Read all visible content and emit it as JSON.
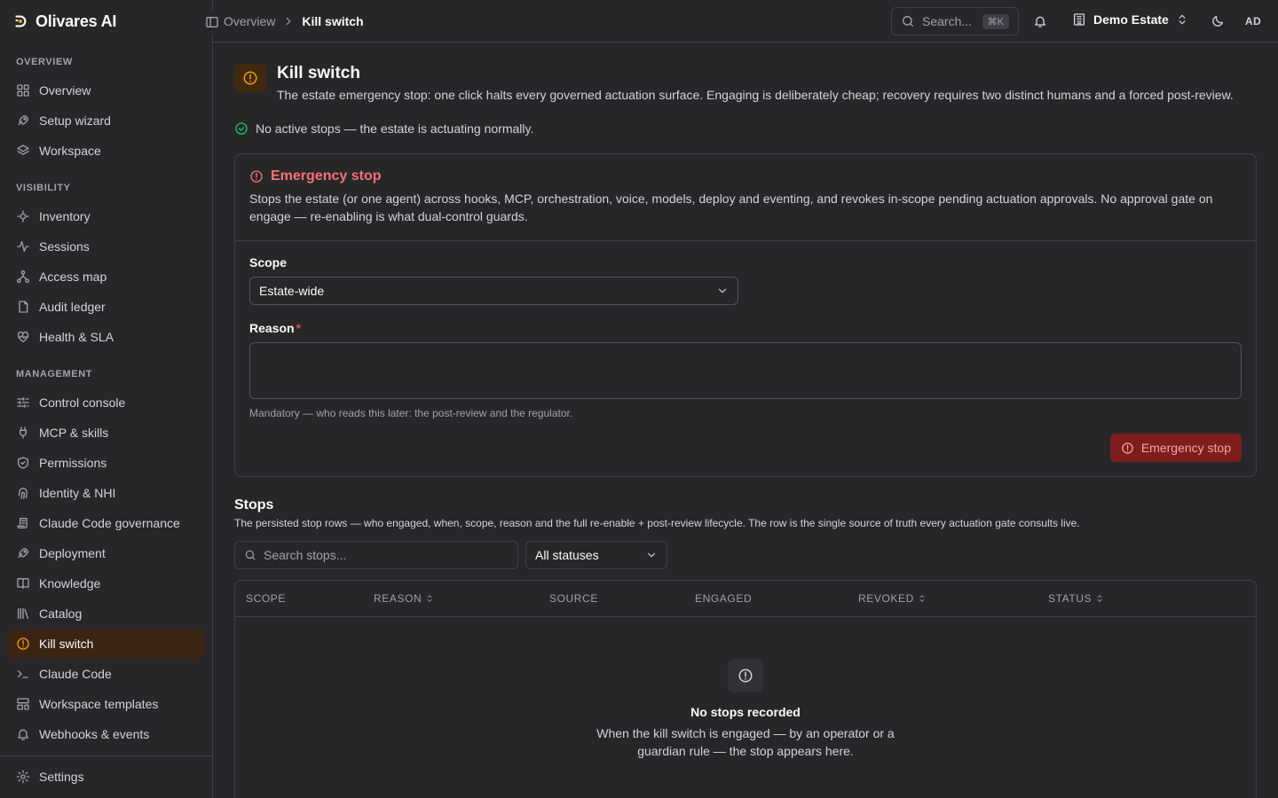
{
  "app": {
    "name": "Olivares AI"
  },
  "sidebar": {
    "sections": [
      {
        "label": "OVERVIEW",
        "items": [
          {
            "label": "Overview",
            "icon": "dashboard-icon"
          },
          {
            "label": "Setup wizard",
            "icon": "rocket-icon"
          },
          {
            "label": "Workspace",
            "icon": "layers-icon"
          }
        ]
      },
      {
        "label": "VISIBILITY",
        "items": [
          {
            "label": "Inventory",
            "icon": "inventory-icon"
          },
          {
            "label": "Sessions",
            "icon": "activity-icon"
          },
          {
            "label": "Access map",
            "icon": "network-icon"
          },
          {
            "label": "Audit ledger",
            "icon": "file-icon"
          },
          {
            "label": "Health & SLA",
            "icon": "heart-pulse-icon"
          }
        ]
      },
      {
        "label": "MANAGEMENT",
        "items": [
          {
            "label": "Control console",
            "icon": "sliders-icon"
          },
          {
            "label": "MCP & skills",
            "icon": "plug-icon"
          },
          {
            "label": "Permissions",
            "icon": "shield-icon"
          },
          {
            "label": "Identity & NHI",
            "icon": "fingerprint-icon"
          },
          {
            "label": "Claude Code governance",
            "icon": "scroll-icon"
          },
          {
            "label": "Deployment",
            "icon": "rocket-icon"
          },
          {
            "label": "Knowledge",
            "icon": "book-icon"
          },
          {
            "label": "Catalog",
            "icon": "library-icon"
          },
          {
            "label": "Kill switch",
            "icon": "alert-circle-icon",
            "active": true
          },
          {
            "label": "Claude Code",
            "icon": "terminal-icon"
          },
          {
            "label": "Workspace templates",
            "icon": "template-icon"
          },
          {
            "label": "Webhooks & events",
            "icon": "bell-icon"
          }
        ]
      }
    ],
    "footer": {
      "label": "Settings",
      "icon": "gear-icon"
    }
  },
  "topbar": {
    "breadcrumb": [
      "Overview",
      "Kill switch"
    ],
    "search_placeholder": "Search...",
    "search_shortcut": "⌘K",
    "estate": "Demo Estate",
    "avatar": "AD"
  },
  "page": {
    "title": "Kill switch",
    "description": "The estate emergency stop: one click halts every governed actuation surface. Engaging is deliberately cheap; recovery requires two distinct humans and a forced post-review.",
    "status": "No active stops — the estate is actuating normally."
  },
  "emergency": {
    "title": "Emergency stop",
    "description": "Stops the estate (or one agent) across hooks, MCP, orchestration, voice, models, deploy and eventing, and revokes in-scope pending actuation approvals. No approval gate on engage — re-enabling is what dual-control guards.",
    "scope_label": "Scope",
    "scope_value": "Estate-wide",
    "reason_label": "Reason",
    "reason_required": "*",
    "reason_value": "",
    "reason_hint": "Mandatory — who reads this later: the post-review and the regulator.",
    "button": "Emergency stop"
  },
  "stops": {
    "title": "Stops",
    "description": "The persisted stop rows — who engaged, when, scope, reason and the full re-enable + post-review lifecycle. The row is the single source of truth every actuation gate consults live.",
    "search_placeholder": "Search stops...",
    "status_filter": "All statuses",
    "columns": [
      {
        "label": "SCOPE",
        "sortable": false
      },
      {
        "label": "REASON",
        "sortable": true
      },
      {
        "label": "SOURCE",
        "sortable": false
      },
      {
        "label": "ENGAGED",
        "sortable": false
      },
      {
        "label": "REVOKED",
        "sortable": true
      },
      {
        "label": "STATUS",
        "sortable": true
      }
    ],
    "empty_title": "No stops recorded",
    "empty_desc": "When the kill switch is engaged — by an operator or a guardian rule — the stop appears here."
  },
  "colors": {
    "background": "#27272a",
    "accent": "#f59e0b",
    "danger": "#f87171",
    "success": "#22c55e"
  }
}
